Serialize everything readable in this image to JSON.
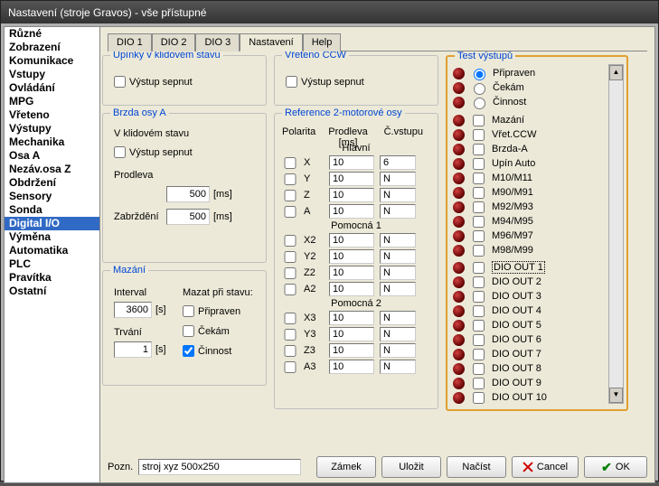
{
  "title": "Nastavení (stroje Gravos) - vše přístupné",
  "sidebar": [
    "Různé",
    "Zobrazení",
    "Komunikace",
    "Vstupy",
    "Ovládání",
    "MPG",
    "Vřeteno",
    "Výstupy",
    "Mechanika",
    "Osa A",
    "Nezáv.osa Z",
    "Obdržení",
    "Sensory",
    "Sonda",
    "Digital I/O",
    "Výměna",
    "Automatika",
    "PLC",
    "Pravítka",
    "Ostatní"
  ],
  "sidebar_selected": 14,
  "tabs": [
    "DIO 1",
    "DIO 2",
    "DIO 3",
    "Nastavení",
    "Help"
  ],
  "tab_selected": 3,
  "grp_upinky": "Upínky v klidovém stavu",
  "grp_vreteno": "Vřeteno CCW",
  "grp_brzda": "Brzda osy A",
  "grp_ref": "Reference 2-motorové osy",
  "grp_mazani": "Mazání",
  "grp_test": "Test výstupů",
  "lbl_vystup_sepnut": "Výstup sepnut",
  "lbl_vklidu": "V klidovém stavu",
  "lbl_prodleva": "Prodleva",
  "lbl_zabrzdeni": "Zabrždění",
  "lbl_ms": "[ms]",
  "lbl_interval": "Interval",
  "lbl_trvani": "Trvání",
  "lbl_s": "[s]",
  "lbl_mazat": "Mazat při stavu:",
  "lbl_pripraven": "Připraven",
  "lbl_cekam": "Čekám",
  "lbl_cinnost": "Činnost",
  "lbl_polarita": "Polarita",
  "lbl_prodleva_ms": "Prodleva [ms]",
  "lbl_cvstupu": "Č.vstupu",
  "lbl_hlavni": "Hlavní",
  "lbl_pomocna1": "Pomocná 1",
  "lbl_pomocna2": "Pomocná 2",
  "brzda_prodleva": "500",
  "brzda_zabrzdeni": "500",
  "mazani_interval": "3600",
  "mazani_trvani": "1",
  "axes_main": [
    [
      "X",
      "10",
      "6"
    ],
    [
      "Y",
      "10",
      "N"
    ],
    [
      "Z",
      "10",
      "N"
    ],
    [
      "A",
      "10",
      "N"
    ]
  ],
  "axes_p1": [
    [
      "X2",
      "10",
      "N"
    ],
    [
      "Y2",
      "10",
      "N"
    ],
    [
      "Z2",
      "10",
      "N"
    ],
    [
      "A2",
      "10",
      "N"
    ]
  ],
  "axes_p2": [
    [
      "X3",
      "10",
      "N"
    ],
    [
      "Y3",
      "10",
      "N"
    ],
    [
      "Z3",
      "10",
      "N"
    ],
    [
      "A3",
      "10",
      "N"
    ]
  ],
  "outputs_radio": [
    "Připraven",
    "Čekám",
    "Činnost"
  ],
  "outputs_radio_sel": 0,
  "outputs": [
    "Mazání",
    "Vřet.CCW",
    "Brzda-A",
    "Upín Auto",
    "M10/M11",
    "M90/M91",
    "M92/M93",
    "M94/M95",
    "M96/M97",
    "M98/M99"
  ],
  "outputs_dio": [
    "DIO OUT 1",
    "DIO OUT 2",
    "DIO OUT 3",
    "DIO OUT 4",
    "DIO OUT 5",
    "DIO OUT 6",
    "DIO OUT 7",
    "DIO OUT 8",
    "DIO OUT 9",
    "DIO OUT 10"
  ],
  "outputs_dio_sel": 0,
  "footer_pozn": "Pozn.",
  "footer_text": "stroj xyz 500x250",
  "btn_zamek": "Zámek",
  "btn_ulozit": "Uložit",
  "btn_nacist": "Načíst",
  "btn_cancel": "Cancel",
  "btn_ok": "OK"
}
